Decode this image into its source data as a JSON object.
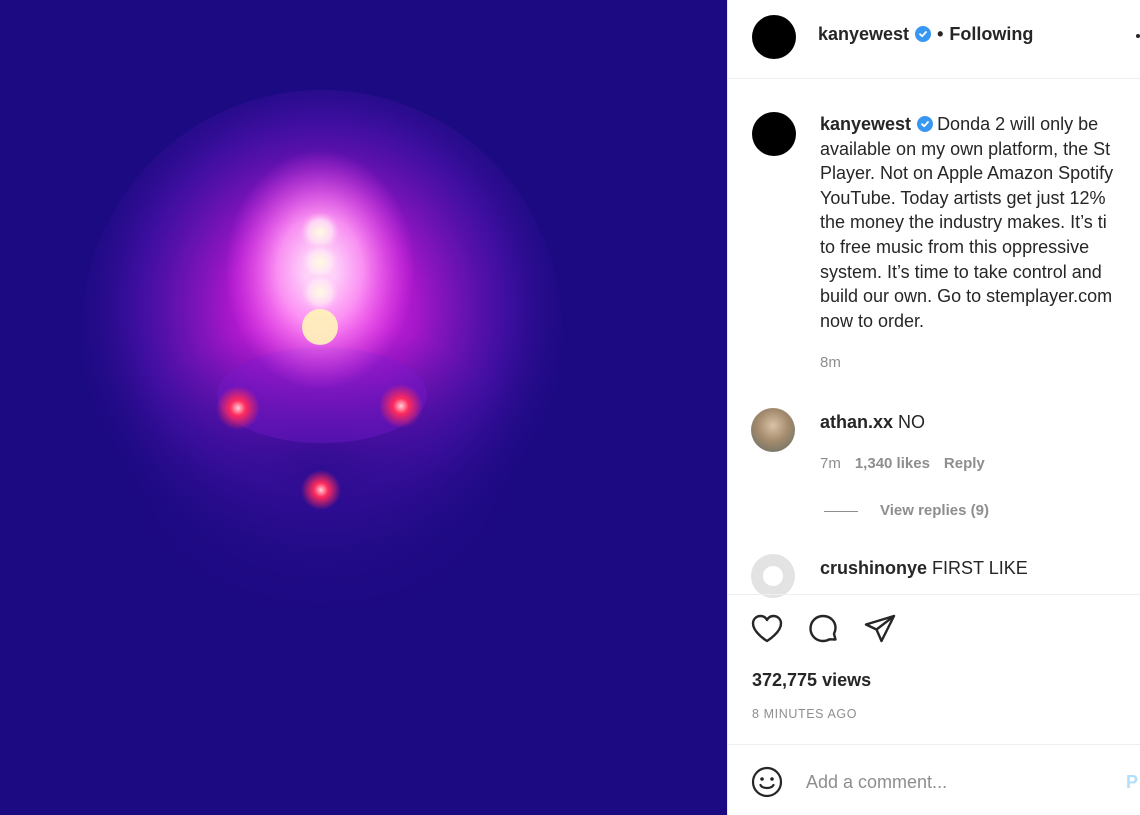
{
  "post": {
    "author": "kanyewest",
    "follow_state": "Following",
    "separator": "•",
    "caption_lines": [
      "Donda 2 will only be",
      "available on my own platform, the St",
      "Player. Not on Apple Amazon Spotify",
      "YouTube. Today artists get just 12%",
      "the money the industry makes. It’s ti",
      "to free music from this oppressive",
      "system. It’s time to take control and",
      "build our own. Go to stemplayer.com",
      "now to order."
    ],
    "caption_time": "8m",
    "views": "372,775 views",
    "posted_ago": "8 MINUTES AGO"
  },
  "comments": [
    {
      "user": "athan.xx",
      "text": "NO",
      "time": "7m",
      "likes": "1,340 likes",
      "reply": "Reply"
    },
    {
      "user": "crushinonye",
      "text": "FIRST LIKE"
    }
  ],
  "view_replies": "View replies (9)",
  "composer": {
    "placeholder": "Add a comment...",
    "post_label": "P"
  },
  "icons": {
    "verified": "verified-badge-icon",
    "like": "heart-icon",
    "comment": "comment-bubble-icon",
    "share": "paper-plane-icon",
    "emoji": "smiley-face-icon"
  },
  "colors": {
    "media_background": "#1c0a82",
    "verified_blue": "#3897f0",
    "muted_text": "#8e8e8e",
    "post_button_disabled": "#b2dffc"
  }
}
